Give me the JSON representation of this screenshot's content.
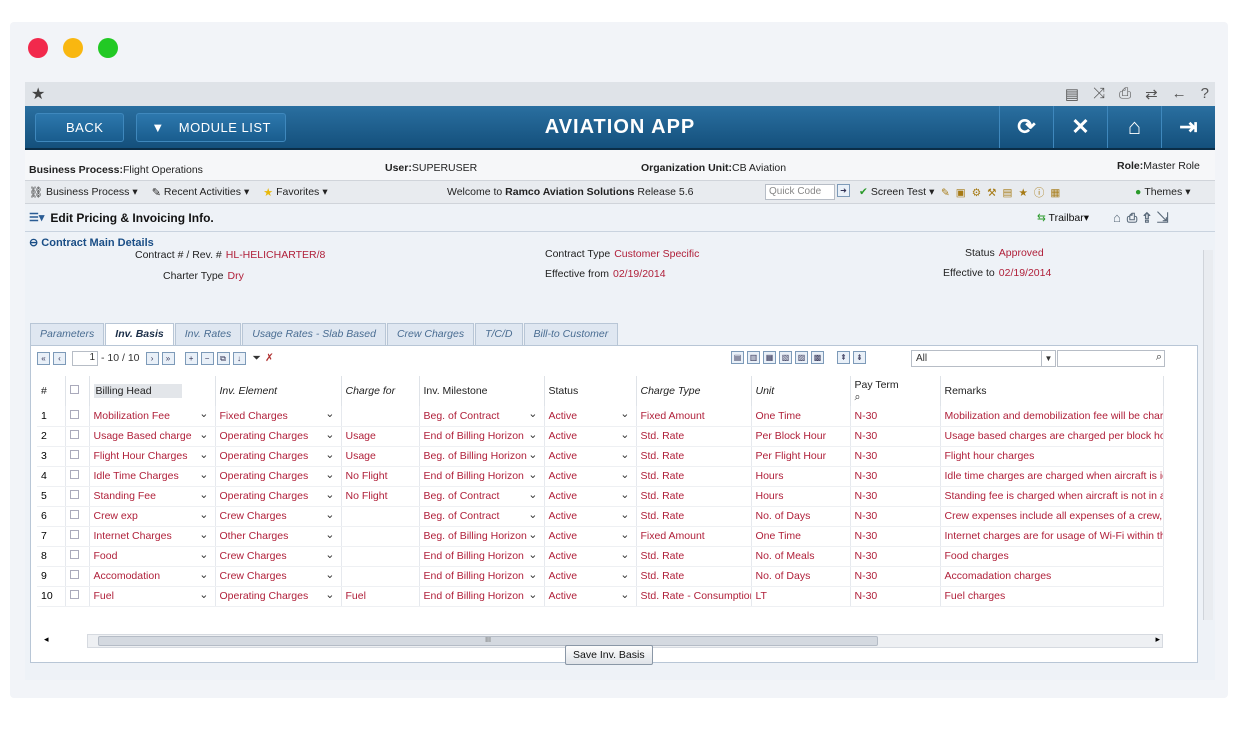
{
  "window": {
    "dot_colors": [
      "#f2294c",
      "#f9b710",
      "#22c924"
    ]
  },
  "topstrip": {
    "icons": [
      "star-icon",
      "list-icon",
      "shuffle-icon",
      "print-icon",
      "swap-icon",
      "back-arrow-icon",
      "help-icon"
    ]
  },
  "nav": {
    "back": "BACK",
    "module_list": "MODULE LIST",
    "title": "AVIATION APP"
  },
  "info": {
    "bp_label": "Business Process:",
    "bp_value": "Flight Operations",
    "user_label": "User:",
    "user_value": "SUPERUSER",
    "org_label": "Organization Unit:",
    "org_value": "CB Aviation",
    "role_label": "Role:",
    "role_value": "Master Role"
  },
  "toolbar": {
    "business_process": "Business Process",
    "recent_activities": "Recent Activities",
    "favorites": "Favorites",
    "welcome": "Welcome to",
    "brand": "Ramco Aviation Solutions",
    "release": "Release 5.6",
    "quick_code_placeholder": "Quick Code",
    "screen_test": "Screen Test",
    "themes": "Themes"
  },
  "page": {
    "title": "Edit Pricing & Invoicing Info.",
    "trailbar": "Trailbar"
  },
  "contract": {
    "section_title": "Contract Main Details",
    "contract_label": "Contract # / Rev. #",
    "contract_value": "HL-HELICHARTER/8",
    "charter_label": "Charter Type",
    "charter_value": "Dry",
    "type_label": "Contract Type",
    "type_value": "Customer Specific",
    "eff_from_label": "Effective from",
    "eff_from_value": "02/19/2014",
    "status_label": "Status",
    "status_value": "Approved",
    "eff_to_label": "Effective to",
    "eff_to_value": "02/19/2014"
  },
  "tabs": [
    "Parameters",
    "Inv. Basis",
    "Inv. Rates",
    "Usage Rates - Slab Based",
    "Crew Charges",
    "T/C/D",
    "Bill-to Customer"
  ],
  "grid": {
    "page_value": "1",
    "page_range": "- 10 / 10",
    "filter_value": "All",
    "columns": [
      "#",
      "Billing Head",
      "Inv. Element",
      "Charge for",
      "Inv. Milestone",
      "Status",
      "Charge Type",
      "Unit",
      "Pay Term",
      "Remarks"
    ],
    "rows": [
      {
        "n": "1",
        "head": "Mobilization Fee",
        "element": "Fixed Charges",
        "charge_for": "",
        "milestone": "Beg. of Contract",
        "status": "Active",
        "type": "Fixed Amount",
        "unit": "One Time",
        "term": "N-30",
        "remarks": "Mobilization and demobilization fee will be charged ex"
      },
      {
        "n": "2",
        "head": "Usage Based charge",
        "element": "Operating Charges",
        "charge_for": "Usage",
        "milestone": "End of Billing Horizon",
        "status": "Active",
        "type": "Std. Rate",
        "unit": "Per Block Hour",
        "term": "N-30",
        "remarks": "Usage based charges are charged per block hour an"
      },
      {
        "n": "3",
        "head": "Flight Hour Charges",
        "element": "Operating Charges",
        "charge_for": "Usage",
        "milestone": "Beg. of Billing Horizon",
        "status": "Active",
        "type": "Std. Rate",
        "unit": "Per Flight Hour",
        "term": "N-30",
        "remarks": "Flight hour charges"
      },
      {
        "n": "4",
        "head": "Idle Time Charges",
        "element": "Operating Charges",
        "charge_for": "No Flight",
        "milestone": "End of Billing Horizon",
        "status": "Active",
        "type": "Std. Rate",
        "unit": "Hours",
        "term": "N-30",
        "remarks": "Idle time charges are charged when aircraft is idle w"
      },
      {
        "n": "5",
        "head": "Standing Fee",
        "element": "Operating Charges",
        "charge_for": "No Flight",
        "milestone": "Beg. of Contract",
        "status": "Active",
        "type": "Std. Rate",
        "unit": "Hours",
        "term": "N-30",
        "remarks": "Standing fee is charged when aircraft is not in air bu"
      },
      {
        "n": "6",
        "head": "Crew exp",
        "element": "Crew Charges",
        "charge_for": "",
        "milestone": "Beg. of Contract",
        "status": "Active",
        "type": "Std. Rate",
        "unit": "No. of Days",
        "term": "N-30",
        "remarks": "Crew expenses include all expenses of a crew, but n"
      },
      {
        "n": "7",
        "head": "Internet Charges",
        "element": "Other Charges",
        "charge_for": "",
        "milestone": "Beg. of Billing Horizon",
        "status": "Active",
        "type": "Fixed Amount",
        "unit": "One Time",
        "term": "N-30",
        "remarks": "Internet charges are for usage of Wi-Fi within the ai"
      },
      {
        "n": "8",
        "head": "Food",
        "element": "Crew Charges",
        "charge_for": "",
        "milestone": "End of Billing Horizon",
        "status": "Active",
        "type": "Std. Rate",
        "unit": "No. of Meals",
        "term": "N-30",
        "remarks": "Food charges"
      },
      {
        "n": "9",
        "head": "Accomodation",
        "element": "Crew Charges",
        "charge_for": "",
        "milestone": "End of Billing Horizon",
        "status": "Active",
        "type": "Std. Rate",
        "unit": "No. of Days",
        "term": "N-30",
        "remarks": "Accomadation charges"
      },
      {
        "n": "10",
        "head": "Fuel",
        "element": "Operating Charges",
        "charge_for": "Fuel",
        "milestone": "End of Billing Horizon",
        "status": "Active",
        "type": "Std. Rate - Consumption",
        "unit": "LT",
        "term": "N-30",
        "remarks": "Fuel charges"
      }
    ]
  },
  "save_button": "Save Inv. Basis"
}
